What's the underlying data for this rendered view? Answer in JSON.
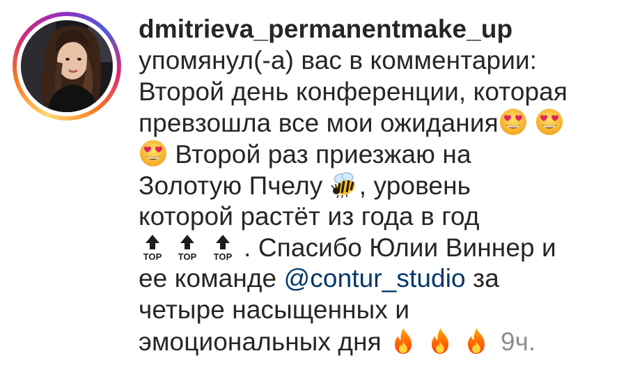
{
  "notification": {
    "username": "dmitrieva_permanentmake_up",
    "action": "упомянул(-а) вас в комментарии:",
    "comment": {
      "line1": "Второй день конференции, которая",
      "line2": "превзошла все мои ожидания",
      "line3": "Второй раз приезжаю на",
      "line4_a": "Золотую Пчелу",
      "line4_b": ", уровень",
      "line5": "которой растёт из года в год",
      "line6": ". Спасибо Юлии Виннер и",
      "line7_a": "ее команде",
      "mention": "@contur_studio",
      "line7_b": "за",
      "line8": "четыре насыщенных и",
      "line9": "эмоциональных дня"
    },
    "time": "9ч.",
    "top_label": "TOP"
  },
  "icons": {
    "heart_eyes": "smiling-face-with-heart-eyes-icon",
    "bee": "honeybee-icon",
    "top": "top-arrow-icon",
    "fire": "fire-icon"
  },
  "colors": {
    "text": "#262626",
    "mention": "#00376b",
    "time": "#8e8e8e",
    "ring_gradient": [
      "#feda75",
      "#fa7e1e",
      "#d62976",
      "#962fbf",
      "#4f5bd5"
    ]
  }
}
